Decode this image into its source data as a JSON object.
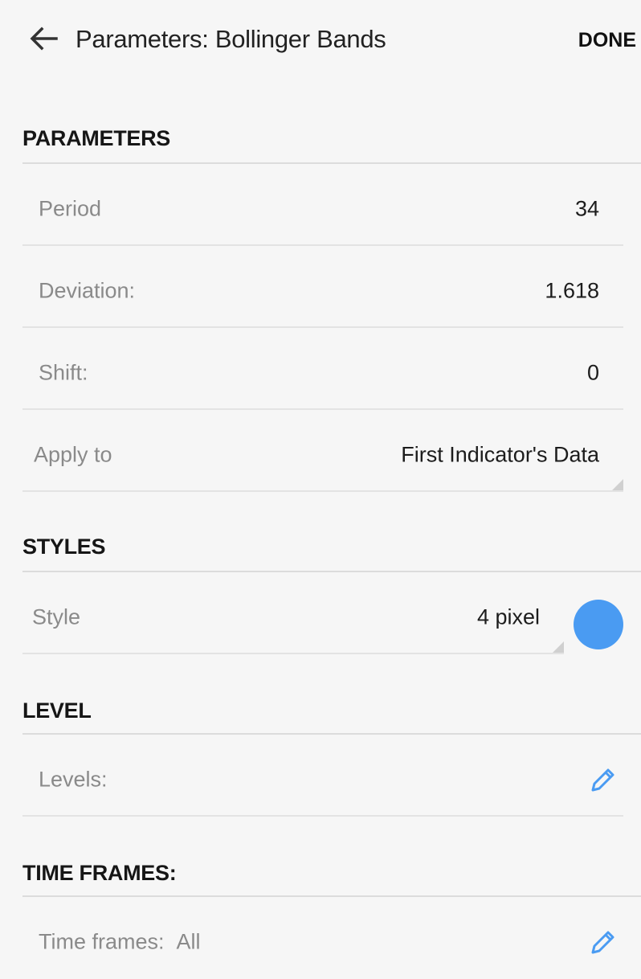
{
  "header": {
    "title": "Parameters: Bollinger Bands",
    "done_label": "DONE"
  },
  "sections": {
    "parameters": {
      "title": "PARAMETERS",
      "period": {
        "label": "Period",
        "value": "34"
      },
      "deviation": {
        "label": "Deviation:",
        "value": "1.618"
      },
      "shift": {
        "label": "Shift:",
        "value": "0"
      },
      "apply_to": {
        "label": "Apply to",
        "value": "First Indicator's Data"
      }
    },
    "styles": {
      "title": "STYLES",
      "style": {
        "label": "Style",
        "value": "4 pixel",
        "color": "#4a9bf2"
      }
    },
    "level": {
      "title": "LEVEL",
      "levels": {
        "label": "Levels:"
      }
    },
    "time_frames": {
      "title": "TIME FRAMES:",
      "time_frames": {
        "label": "Time frames:",
        "value": "All"
      }
    }
  },
  "icons": {
    "back": "arrow-left",
    "edit": "pencil"
  },
  "colors": {
    "accent": "#4a9bf2",
    "background": "#f6f6f6"
  }
}
